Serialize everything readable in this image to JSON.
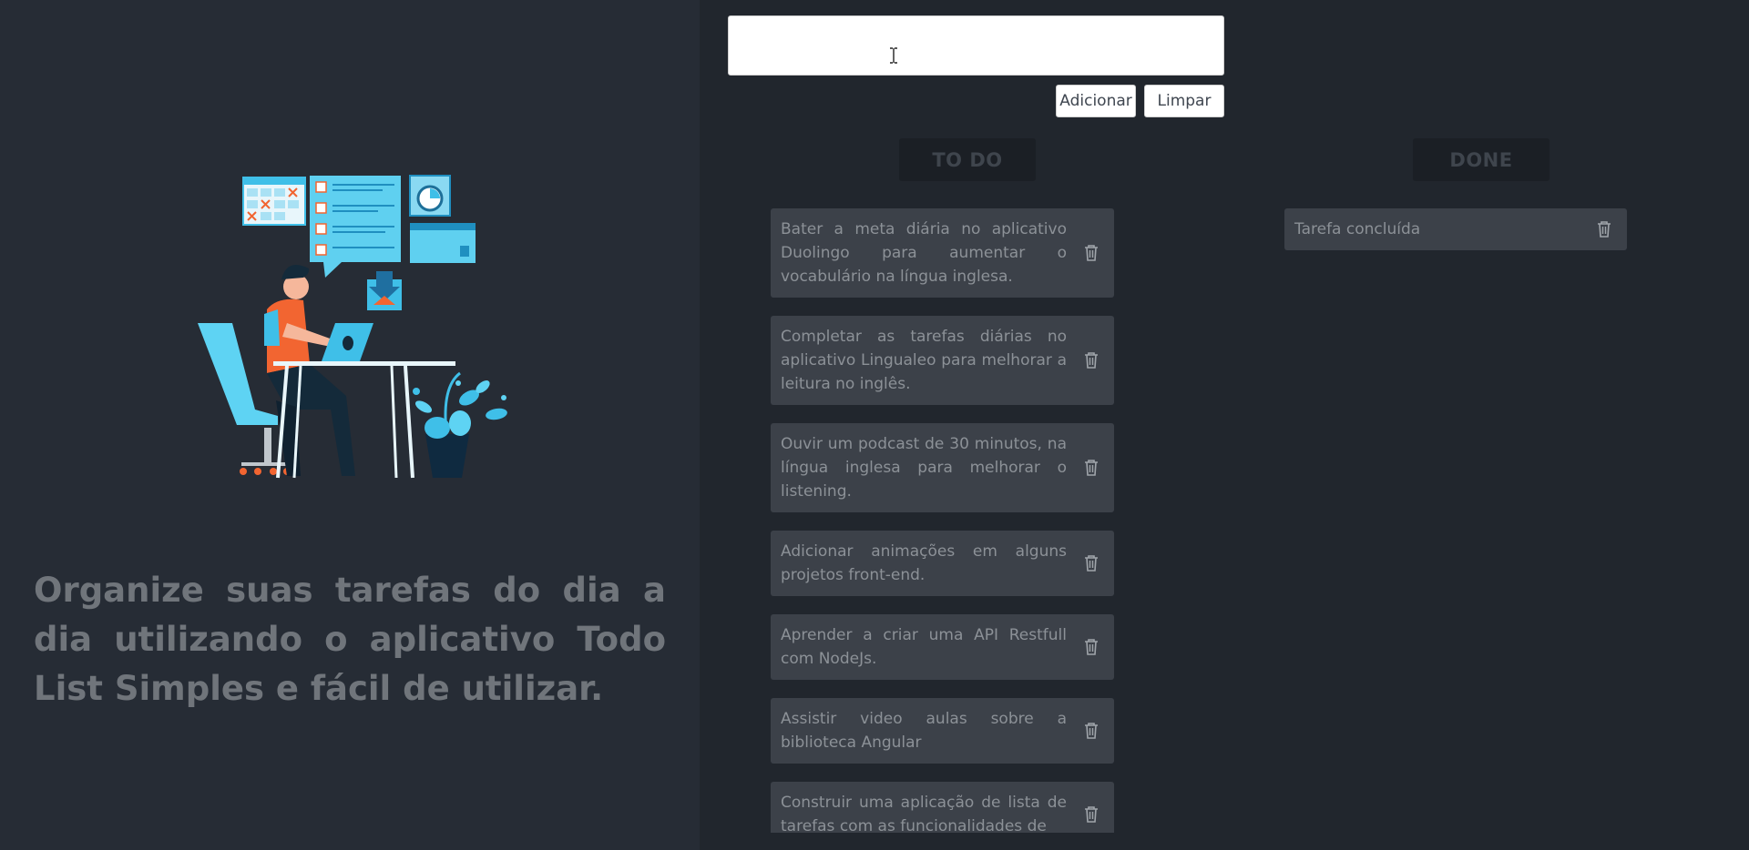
{
  "tagline": "Organize suas tarefas do dia a dia utilizando o aplicativo Todo List Simples e fácil de utilizar.",
  "input": {
    "value": "",
    "placeholder": ""
  },
  "buttons": {
    "add": "Adicionar",
    "clear": "Limpar"
  },
  "columns": {
    "todo": {
      "title": "TO DO",
      "tasks": [
        "Bater a meta diária no aplicativo Duolingo para aumentar o vocabulário na língua inglesa.",
        "Completar as tarefas diárias no aplicativo Lingualeo para melhorar a leitura no inglês.",
        "Ouvir um podcast de 30 minutos, na língua inglesa para melhorar o listening.",
        "Adicionar animações em alguns projetos front-end.",
        "Aprender a criar uma API Restfull com NodeJs.",
        "Assistir video aulas sobre a biblioteca Angular",
        "Construir uma aplicação de lista de tarefas com as funcionalidades de"
      ]
    },
    "done": {
      "title": "DONE",
      "tasks": [
        "Tarefa concluída"
      ]
    }
  },
  "icons": {
    "delete": "trash-icon",
    "illustration": "person-at-desk-illustration",
    "cursor": "text-cursor-icon"
  },
  "colors": {
    "left_bg": "#262c35",
    "right_bg": "#21262d",
    "card_bg": "#3c4149",
    "accent_blue": "#3fbfe8",
    "accent_orange": "#f26531"
  }
}
